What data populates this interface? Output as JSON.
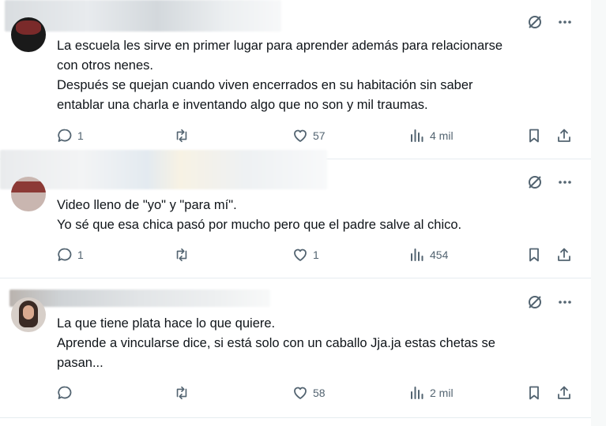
{
  "posts": [
    {
      "text": "La escuela les sirve en primer lugar para aprender además para relacionarse\ncon otros nenes.\nDespués se quejan cuando  viven encerrados en su habitación sin saber\nentablar una charla e inventando algo que no son y mil traumas.",
      "replies": "1",
      "reposts": "",
      "likes": "57",
      "views": "4 mil"
    },
    {
      "text": "Video lleno de \"yo\" y \"para mí\".\nYo sé que esa chica pasó por mucho pero que el padre salve al chico.",
      "replies": "1",
      "reposts": "",
      "likes": "1",
      "views": "454"
    },
    {
      "text": "La que tiene plata hace lo que quiere.\nAprende a vincularse dice, si está  solo con un caballo Jja.ja estas chetas se\npasan...",
      "replies": "",
      "reposts": "",
      "likes": "58",
      "views": "2 mil"
    }
  ],
  "icons": {
    "hide": "eye-slash-icon",
    "more": "more-icon",
    "reply": "reply-icon",
    "repost": "repost-icon",
    "like": "heart-icon",
    "views": "views-icon",
    "bookmark": "bookmark-icon",
    "share": "share-icon"
  },
  "colors": {
    "icon_gray": "#536471",
    "text": "#0f1419",
    "divider": "#e6ecf0"
  }
}
